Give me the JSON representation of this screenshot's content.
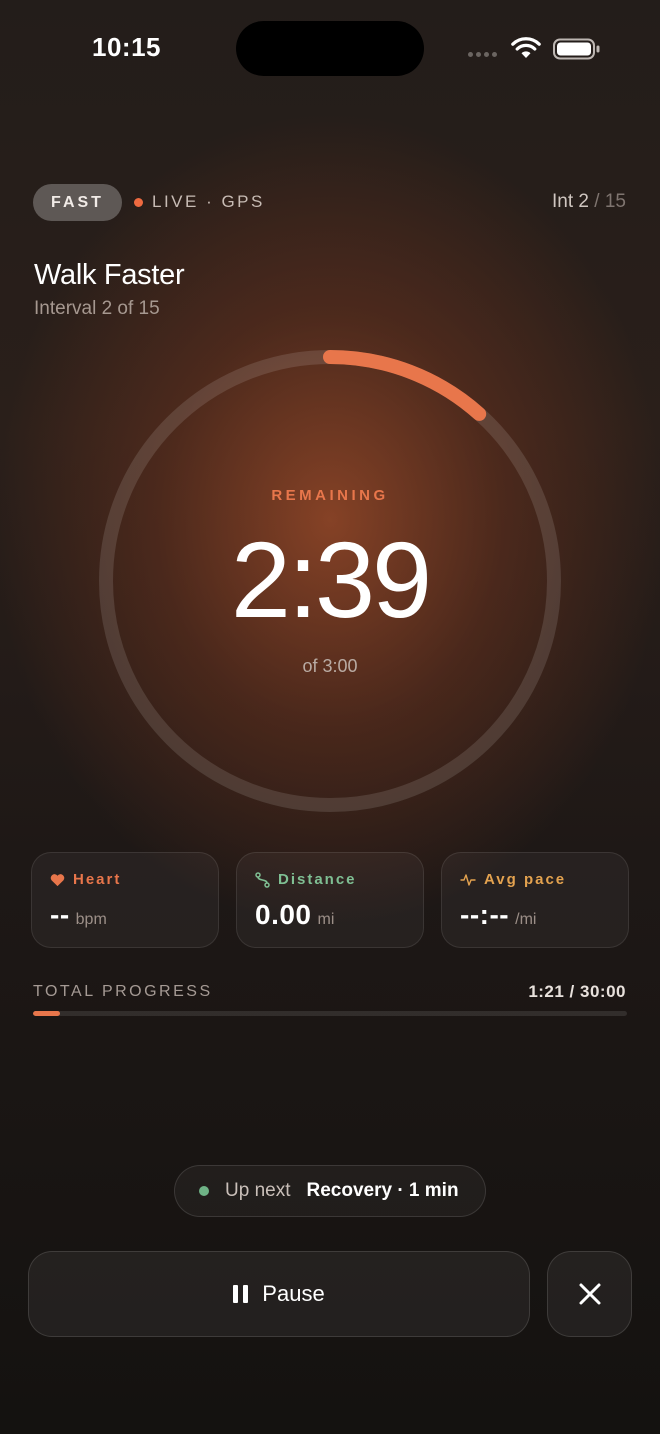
{
  "status_bar": {
    "time": "10:15"
  },
  "header": {
    "mode": "FAST",
    "live_text": "LIVE · GPS",
    "interval_current": "Int 2",
    "interval_total": " / 15"
  },
  "workout": {
    "title": "Walk Faster",
    "subtitle": "Interval 2 of 15"
  },
  "timer": {
    "label": "REMAINING",
    "remaining": "2:39",
    "of_total": "of 3:00",
    "ring_progress": 0.116,
    "accent_color": "#e8764b"
  },
  "stats": [
    {
      "label": "Heart",
      "value": "--",
      "unit": "bpm",
      "icon": "heart-icon",
      "color": "#e8764b"
    },
    {
      "label": "Distance",
      "value": "0.00",
      "unit": "mi",
      "icon": "route-icon",
      "color": "#7fbf93"
    },
    {
      "label": "Avg pace",
      "value": "--:--",
      "unit": "/mi",
      "icon": "pulse-icon",
      "color": "#e3a24f"
    }
  ],
  "total_progress": {
    "label": "TOTAL PROGRESS",
    "value": "1:21 / 30:00",
    "fraction": 0.045
  },
  "up_next": {
    "label": "Up next",
    "value": "Recovery · 1 min",
    "dot_color": "#6fb386"
  },
  "controls": {
    "pause_label": "Pause",
    "close_icon": "close-icon"
  }
}
